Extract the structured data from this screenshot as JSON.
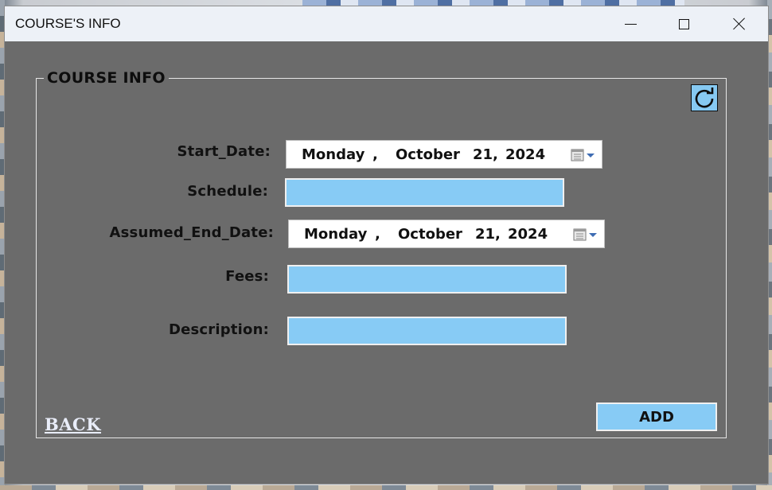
{
  "window": {
    "title": "COURSE'S INFO",
    "controls": {
      "minimize": "minimize-icon",
      "maximize": "maximize-icon",
      "close": "close-icon"
    }
  },
  "panel": {
    "legend": "COURSE INFO",
    "refresh_icon": "refresh-icon"
  },
  "form": {
    "start_date": {
      "label": "Start_Date:",
      "weekday": "Monday",
      "separator": ",",
      "month": "October",
      "day": "21,",
      "year": "2024"
    },
    "schedule": {
      "label": "Schedule:",
      "value": ""
    },
    "assumed_end_date": {
      "label": "Assumed_End_Date:",
      "weekday": "Monday",
      "separator": ",",
      "month": "October",
      "day": "21,",
      "year": "2024"
    },
    "fees": {
      "label": "Fees:",
      "value": ""
    },
    "description": {
      "label": "Description:",
      "value": ""
    }
  },
  "actions": {
    "back_label": "BACK",
    "add_label": "ADD"
  },
  "colors": {
    "window_bg": "#6b6b6b",
    "field_bg": "#87cbf5",
    "titlebar_bg": "#edf1f7"
  }
}
